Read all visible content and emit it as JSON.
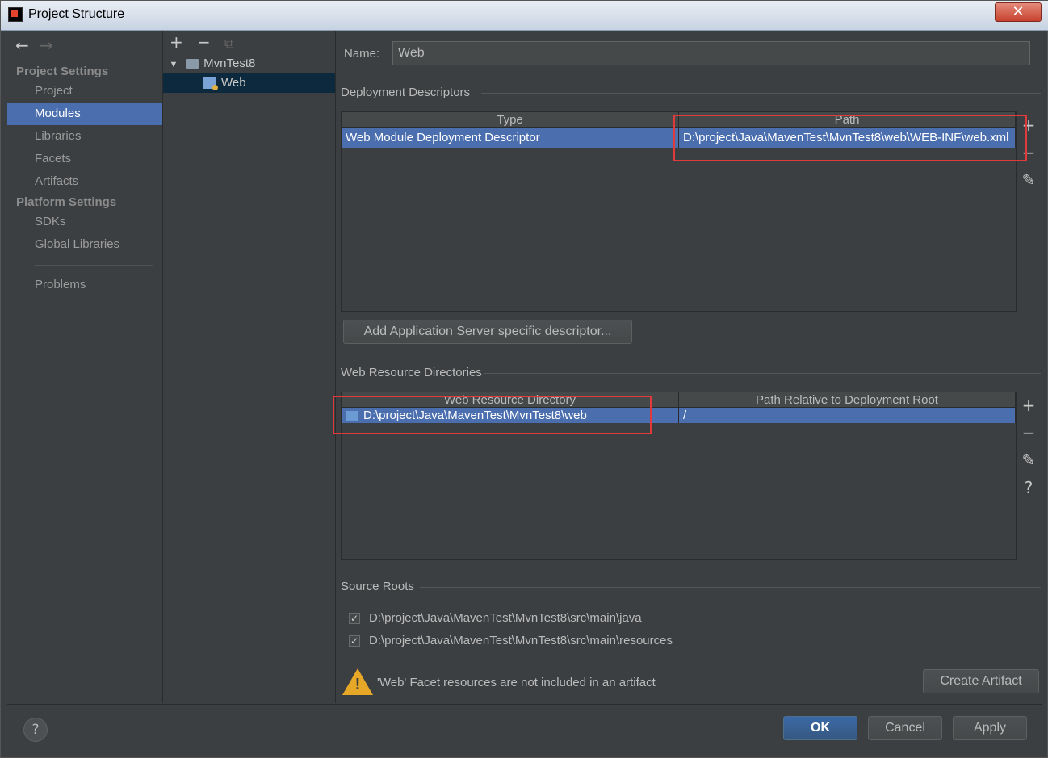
{
  "window": {
    "title": "Project Structure",
    "close_glyph": "✕"
  },
  "nav": {
    "back_glyph": "←",
    "forward_glyph": "→",
    "project_settings_header": "Project Settings",
    "platform_settings_header": "Platform Settings",
    "items": {
      "project": "Project",
      "modules": "Modules",
      "libraries": "Libraries",
      "facets": "Facets",
      "artifacts": "Artifacts",
      "sdks": "SDKs",
      "global_libraries": "Global Libraries",
      "problems": "Problems"
    },
    "selected": "Modules"
  },
  "tree": {
    "toolbar": {
      "add": "+",
      "remove": "−",
      "copy": "⧉"
    },
    "root": {
      "label": "MvnTest8",
      "expander": "▼"
    },
    "child": {
      "label": "Web"
    }
  },
  "main": {
    "name_label": "Name:",
    "name_value": "Web",
    "deployment_descriptors": {
      "title": "Deployment Descriptors",
      "columns": [
        "Type",
        "Path"
      ],
      "rows": [
        {
          "type": "Web Module Deployment Descriptor",
          "path": "D:\\project\\Java\\MavenTest\\MvnTest8\\web\\WEB-INF\\web.xml"
        }
      ],
      "add_server_button": "Add Application Server specific descriptor..."
    },
    "web_resource_directories": {
      "title": "Web Resource Directories",
      "columns": [
        "Web Resource Directory",
        "Path Relative to Deployment Root"
      ],
      "rows": [
        {
          "directory": "D:\\project\\Java\\MavenTest\\MvnTest8\\web",
          "relative": "/"
        }
      ]
    },
    "source_roots": {
      "title": "Source Roots",
      "items": [
        {
          "path": "D:\\project\\Java\\MavenTest\\MvnTest8\\src\\main\\java",
          "checked": true
        },
        {
          "path": "D:\\project\\Java\\MavenTest\\MvnTest8\\src\\main\\resources",
          "checked": true
        }
      ]
    },
    "warning": {
      "text": "'Web' Facet resources are not included in an artifact",
      "create_artifact_button": "Create Artifact"
    },
    "side_tools": {
      "add": "+",
      "remove": "−",
      "edit": "✎",
      "help": "?"
    }
  },
  "footer": {
    "help": "?",
    "ok": "OK",
    "cancel": "Cancel",
    "apply": "Apply"
  },
  "colors": {
    "selection": "#4b6eaf",
    "panel": "#3c3f41",
    "highlight_box": "#e23a3a",
    "warning": "#e8a827"
  }
}
